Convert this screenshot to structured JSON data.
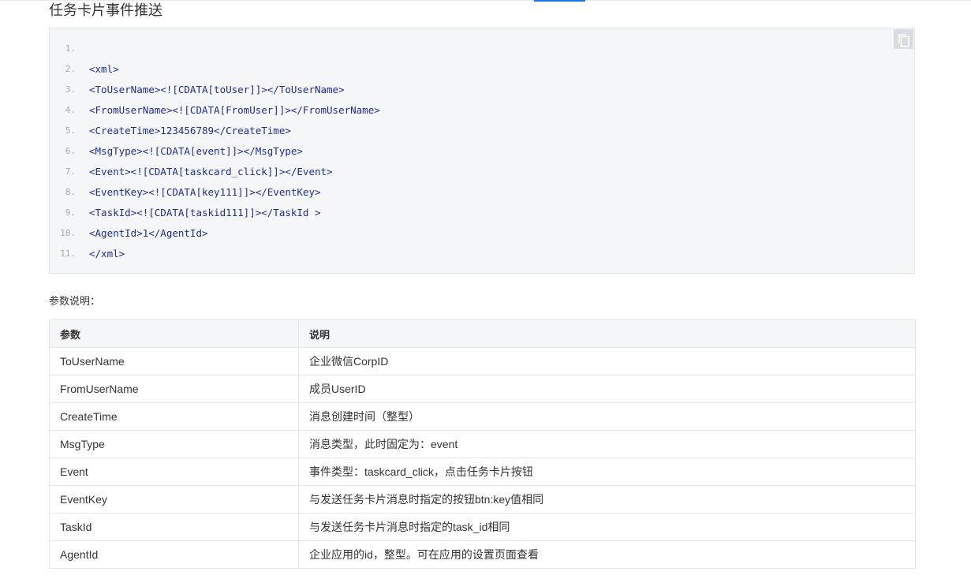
{
  "page": {
    "title": "任务卡片事件推送"
  },
  "code_block": {
    "copy_icon": "copy-icon",
    "lines": [
      {
        "no": "1.",
        "text": ""
      },
      {
        "no": "2.",
        "text": "<xml>"
      },
      {
        "no": "3.",
        "text": "<ToUserName><![CDATA[toUser]]></ToUserName>"
      },
      {
        "no": "4.",
        "text": "<FromUserName><![CDATA[FromUser]]></FromUserName>"
      },
      {
        "no": "5.",
        "text": "<CreateTime>123456789</CreateTime>"
      },
      {
        "no": "6.",
        "text": "<MsgType><![CDATA[event]]></MsgType>"
      },
      {
        "no": "7.",
        "text": "<Event><![CDATA[taskcard_click]]></Event>"
      },
      {
        "no": "8.",
        "text": "<EventKey><![CDATA[key111]]></EventKey>"
      },
      {
        "no": "9.",
        "text": "<TaskId><![CDATA[taskid111]]></TaskId >"
      },
      {
        "no": "10.",
        "text": "<AgentId>1</AgentId>"
      },
      {
        "no": "11.",
        "text": "</xml>"
      }
    ]
  },
  "params": {
    "heading": "参数说明：",
    "headers": [
      "参数",
      "说明"
    ],
    "rows": [
      [
        "ToUserName",
        "企业微信CorpID"
      ],
      [
        "FromUserName",
        "成员UserID"
      ],
      [
        "CreateTime",
        "消息创建时间（整型）"
      ],
      [
        "MsgType",
        "消息类型，此时固定为：event"
      ],
      [
        "Event",
        "事件类型：taskcard_click，点击任务卡片按钮"
      ],
      [
        "EventKey",
        "与发送任务卡片消息时指定的按钮btn:key值相同"
      ],
      [
        "TaskId",
        "与发送任务卡片消息时指定的task_id相同"
      ],
      [
        "AgentId",
        "企业应用的id，整型。可在应用的设置页面查看"
      ]
    ]
  },
  "colors": {
    "code_tag": "#1f2d8f",
    "line_number": "#a4a9b0",
    "code_bg": "#f5f6f8",
    "accent": "#1a73e8"
  }
}
